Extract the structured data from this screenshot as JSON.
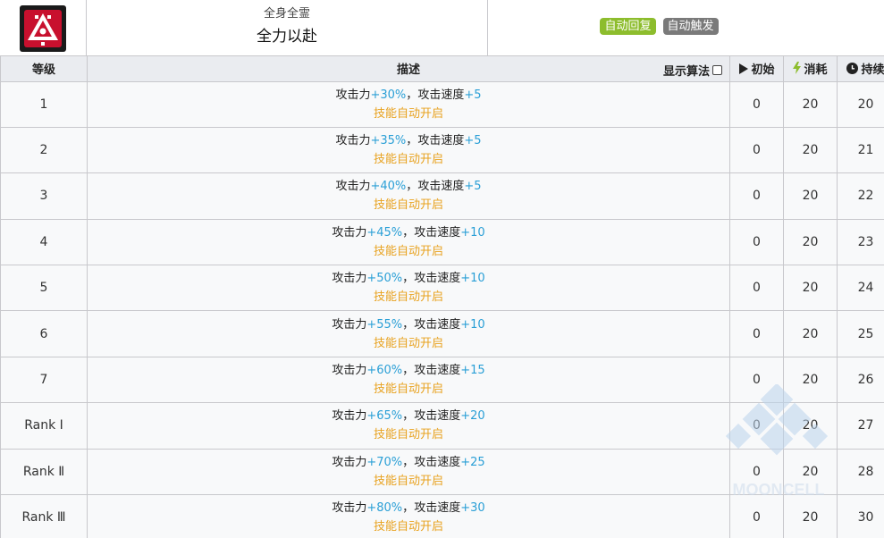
{
  "header": {
    "sub_title": "全身全霊",
    "skill_name": "全力以赴",
    "tags": [
      "自动回复",
      "自动触发"
    ]
  },
  "columns": {
    "level": "等级",
    "description": "描述",
    "show_formula": "显示算法",
    "initial": "初始",
    "cost": "消耗",
    "duration": "持续"
  },
  "colors": {
    "recovery_tag": "#8dbd2d",
    "trigger_tag": "#7a7a7a",
    "value": "#2a9fd6",
    "auto_open": "#e8a21f"
  },
  "rows": [
    {
      "level": "1",
      "atk_label": "攻击力",
      "atk": "+30%",
      "sep": "，",
      "spd_label": "攻击速度",
      "spd": "+5",
      "note": "技能自动开启",
      "initial": "0",
      "cost": "20",
      "duration": "20"
    },
    {
      "level": "2",
      "atk_label": "攻击力",
      "atk": "+35%",
      "sep": "，",
      "spd_label": "攻击速度",
      "spd": "+5",
      "note": "技能自动开启",
      "initial": "0",
      "cost": "20",
      "duration": "21"
    },
    {
      "level": "3",
      "atk_label": "攻击力",
      "atk": "+40%",
      "sep": "，",
      "spd_label": "攻击速度",
      "spd": "+5",
      "note": "技能自动开启",
      "initial": "0",
      "cost": "20",
      "duration": "22"
    },
    {
      "level": "4",
      "atk_label": "攻击力",
      "atk": "+45%",
      "sep": "，",
      "spd_label": "攻击速度",
      "spd": "+10",
      "note": "技能自动开启",
      "initial": "0",
      "cost": "20",
      "duration": "23"
    },
    {
      "level": "5",
      "atk_label": "攻击力",
      "atk": "+50%",
      "sep": "，",
      "spd_label": "攻击速度",
      "spd": "+10",
      "note": "技能自动开启",
      "initial": "0",
      "cost": "20",
      "duration": "24"
    },
    {
      "level": "6",
      "atk_label": "攻击力",
      "atk": "+55%",
      "sep": "，",
      "spd_label": "攻击速度",
      "spd": "+10",
      "note": "技能自动开启",
      "initial": "0",
      "cost": "20",
      "duration": "25"
    },
    {
      "level": "7",
      "atk_label": "攻击力",
      "atk": "+60%",
      "sep": "，",
      "spd_label": "攻击速度",
      "spd": "+15",
      "note": "技能自动开启",
      "initial": "0",
      "cost": "20",
      "duration": "26"
    },
    {
      "level": "Rank Ⅰ",
      "atk_label": "攻击力",
      "atk": "+65%",
      "sep": "，",
      "spd_label": "攻击速度",
      "spd": "+20",
      "note": "技能自动开启",
      "initial": "0",
      "cost": "20",
      "duration": "27"
    },
    {
      "level": "Rank Ⅱ",
      "atk_label": "攻击力",
      "atk": "+70%",
      "sep": "，",
      "spd_label": "攻击速度",
      "spd": "+25",
      "note": "技能自动开启",
      "initial": "0",
      "cost": "20",
      "duration": "28"
    },
    {
      "level": "Rank Ⅲ",
      "atk_label": "攻击力",
      "atk": "+80%",
      "sep": "，",
      "spd_label": "攻击速度",
      "spd": "+30",
      "note": "技能自动开启",
      "initial": "0",
      "cost": "20",
      "duration": "30"
    }
  ],
  "watermark": "MOONCELL"
}
